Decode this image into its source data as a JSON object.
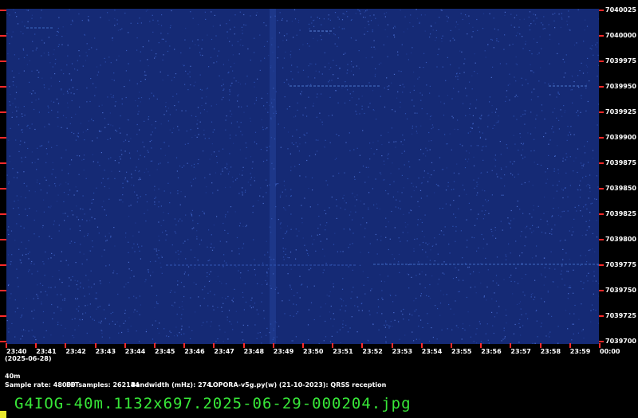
{
  "y_labels": [
    "7040025",
    "7040000",
    "7039975",
    "7039950",
    "7039925",
    "7039900",
    "7039875",
    "7039850",
    "7039825",
    "7039800",
    "7039775",
    "7039750",
    "7039725",
    "7039700"
  ],
  "x_labels": [
    "23:40",
    "23:41",
    "23:42",
    "23:43",
    "23:44",
    "23:45",
    "23:46",
    "23:47",
    "23:48",
    "23:49",
    "23:50",
    "23:51",
    "23:52",
    "23:53",
    "23:54",
    "23:55",
    "23:56",
    "23:57",
    "23:58",
    "23:59",
    "00:00"
  ],
  "date_label": "(2025-06-28)",
  "band": "40m",
  "sample_rate": "Sample rate: 48000",
  "fft_samples": "FFTsamples: 262144",
  "bandwidth": "Bandwidth (mHz): 274",
  "software": "LOPORA-v5g.py(w) (21-10-2023): QRSS reception",
  "filename": "G4IOG-40m.1132x697.2025-06-29-000204.jpg",
  "colors": {
    "background": "#000000",
    "plot": "#152a75",
    "tick": "#ff2a2a",
    "filename": "#38e838",
    "cursor": "#e8e830"
  }
}
